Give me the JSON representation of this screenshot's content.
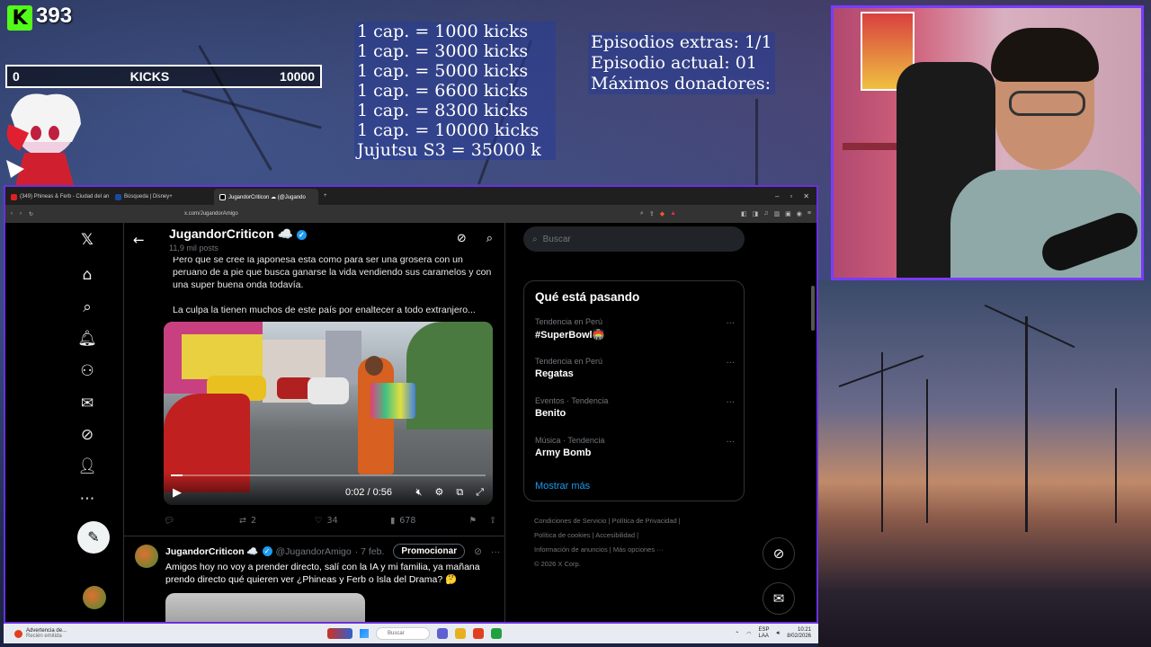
{
  "overlay": {
    "kick_count": "393",
    "kick_logo": "K",
    "kick_bar": {
      "min": "0",
      "label": "KICKS",
      "max": "10000",
      "progress_fraction": 0.039
    },
    "caps": [
      "1 cap. = 1000 kicks",
      "1 cap. = 3000 kicks",
      "1 cap. = 5000 kicks",
      "1 cap. = 6600 kicks",
      "1 cap. = 8300 kicks",
      "1 cap. = 10000 kicks",
      "Jujutsu S3 = 35000 k"
    ],
    "episodes": [
      "Episodios extras: 1/1",
      "Episodio actual: 01",
      "Máximos donadores:"
    ]
  },
  "browser": {
    "tabs": [
      {
        "label": "(349) Phineas & Ferb - Ciudad del an",
        "color": "#e02020",
        "active": false
      },
      {
        "label": "Búsqueda | Disney+",
        "color": "#1a4aa0",
        "active": false
      },
      {
        "label": "JugandorCriticon ☁ (@Jugando",
        "color": "#000000",
        "active": true
      }
    ],
    "url": "x.com/JugandorAmigo",
    "new_tab": "+"
  },
  "x": {
    "profile": {
      "name": "JugandorCriticon ☁️",
      "posts": "11,9 mil posts"
    },
    "tweet": {
      "text": [
        "Pero que se cree la japonesa esta como para ser una grosera con un peruano de a pie que busca ganarse la vida vendiendo sus caramelos y con una super buena onda todavía.",
        "La culpa la tienen muchos de este país por enaltecer a todo extranjero..."
      ],
      "video_time": "0:02 / 0:56",
      "video_progress_fraction": 0.036,
      "replies": "",
      "reposts": "2",
      "likes": "34",
      "views": "678"
    },
    "tweet2": {
      "name": "JugandorCriticon ☁️",
      "handle": "@JugandorAmigo",
      "date": "· 7 feb.",
      "promo": "Promocionar",
      "text": "Amigos hoy no voy a prender directo, salí con la IA y mi familia, ya mañana prendo directo qué quieren ver ¿Phineas y Ferb o Isla del Drama? 🤔"
    },
    "search_placeholder": "Buscar",
    "trends": {
      "title": "Qué está pasando",
      "items": [
        {
          "category": "Tendencia en Perú",
          "name": "#SuperBowl🏟️"
        },
        {
          "category": "Tendencia en Perú",
          "name": "Regatas"
        },
        {
          "category": "Eventos · Tendencia",
          "name": "Benito"
        },
        {
          "category": "Música · Tendencia",
          "name": "Army Bomb"
        }
      ],
      "show_more": "Mostrar más"
    },
    "footer": {
      "line1": "Condiciones de Servicio  |  Política de Privacidad  |",
      "line2": "Política de cookies  |  Accesibilidad  |",
      "line3": "Información de anuncios  |  Más opciones ···",
      "line4": "© 2026 X Corp."
    }
  },
  "taskbar": {
    "notif_title": "Advertencia de...",
    "notif_sub": "Recién emitida",
    "search": "Buscar",
    "lang": "ESP\nLAA",
    "time": "10:21",
    "date": "8/02/2026"
  }
}
